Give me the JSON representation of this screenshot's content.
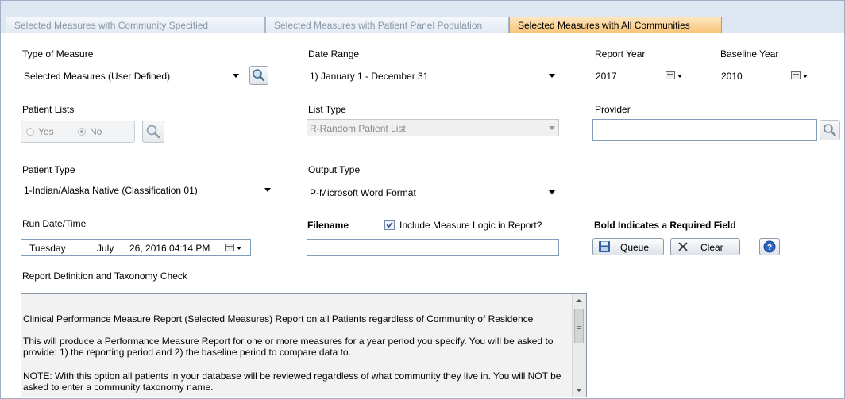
{
  "tabs": [
    {
      "label": "Selected Measures with Community Specified",
      "active": false
    },
    {
      "label": "Selected Measures with Patient Panel Population",
      "active": false
    },
    {
      "label": "Selected Measures with All Communities",
      "active": true
    }
  ],
  "type_of_measure": {
    "label": "Type of Measure",
    "value": "Selected Measures (User Defined)"
  },
  "date_range": {
    "label": "Date Range",
    "value": "1) January 1 - December 31"
  },
  "report_year": {
    "label": "Report Year",
    "value": "2017"
  },
  "baseline_year": {
    "label": "Baseline Year",
    "value": "2010"
  },
  "patient_lists": {
    "label": "Patient Lists",
    "yes_label": "Yes",
    "no_label": "No",
    "selected": "No"
  },
  "list_type": {
    "label": "List Type",
    "value": "R-Random Patient List"
  },
  "provider": {
    "label": "Provider",
    "value": ""
  },
  "patient_type": {
    "label": "Patient Type",
    "value": "1-Indian/Alaska Native (Classification 01)"
  },
  "output_type": {
    "label": "Output Type",
    "value": "P-Microsoft Word Format"
  },
  "run_datetime": {
    "label": "Run Date/Time",
    "day": "Tuesday",
    "month": "July",
    "date_time": "26, 2016 04:14 PM"
  },
  "filename": {
    "label": "Filename",
    "value": ""
  },
  "include_logic": {
    "label": "Include Measure Logic in Report?",
    "checked": true
  },
  "required_note": "Bold Indicates a Required Field",
  "buttons": {
    "queue": "Queue",
    "clear": "Clear"
  },
  "report_definition": {
    "label": "Report Definition and Taxonomy Check",
    "paragraphs": [
      "Clinical Performance Measure Report (Selected Measures) Report on all Patients regardless of Community of Residence",
      "This will produce a Performance Measure Report for one or more measures for a year period you specify.  You will be asked to provide: 1) the reporting period and 2) the baseline period to compare data to.",
      "NOTE:  With this option all patients in your database will be reviewed regardless of what community they live in.  You will NOT be asked to enter a community taxonomy name."
    ]
  },
  "colors": {
    "active_tab": "#f9c57a",
    "tabstrip": "#dde6f1",
    "border": "#7f9db9"
  },
  "icons": [
    "search-icon",
    "calendar-icon",
    "save-icon",
    "clear-x-icon",
    "help-icon"
  ]
}
